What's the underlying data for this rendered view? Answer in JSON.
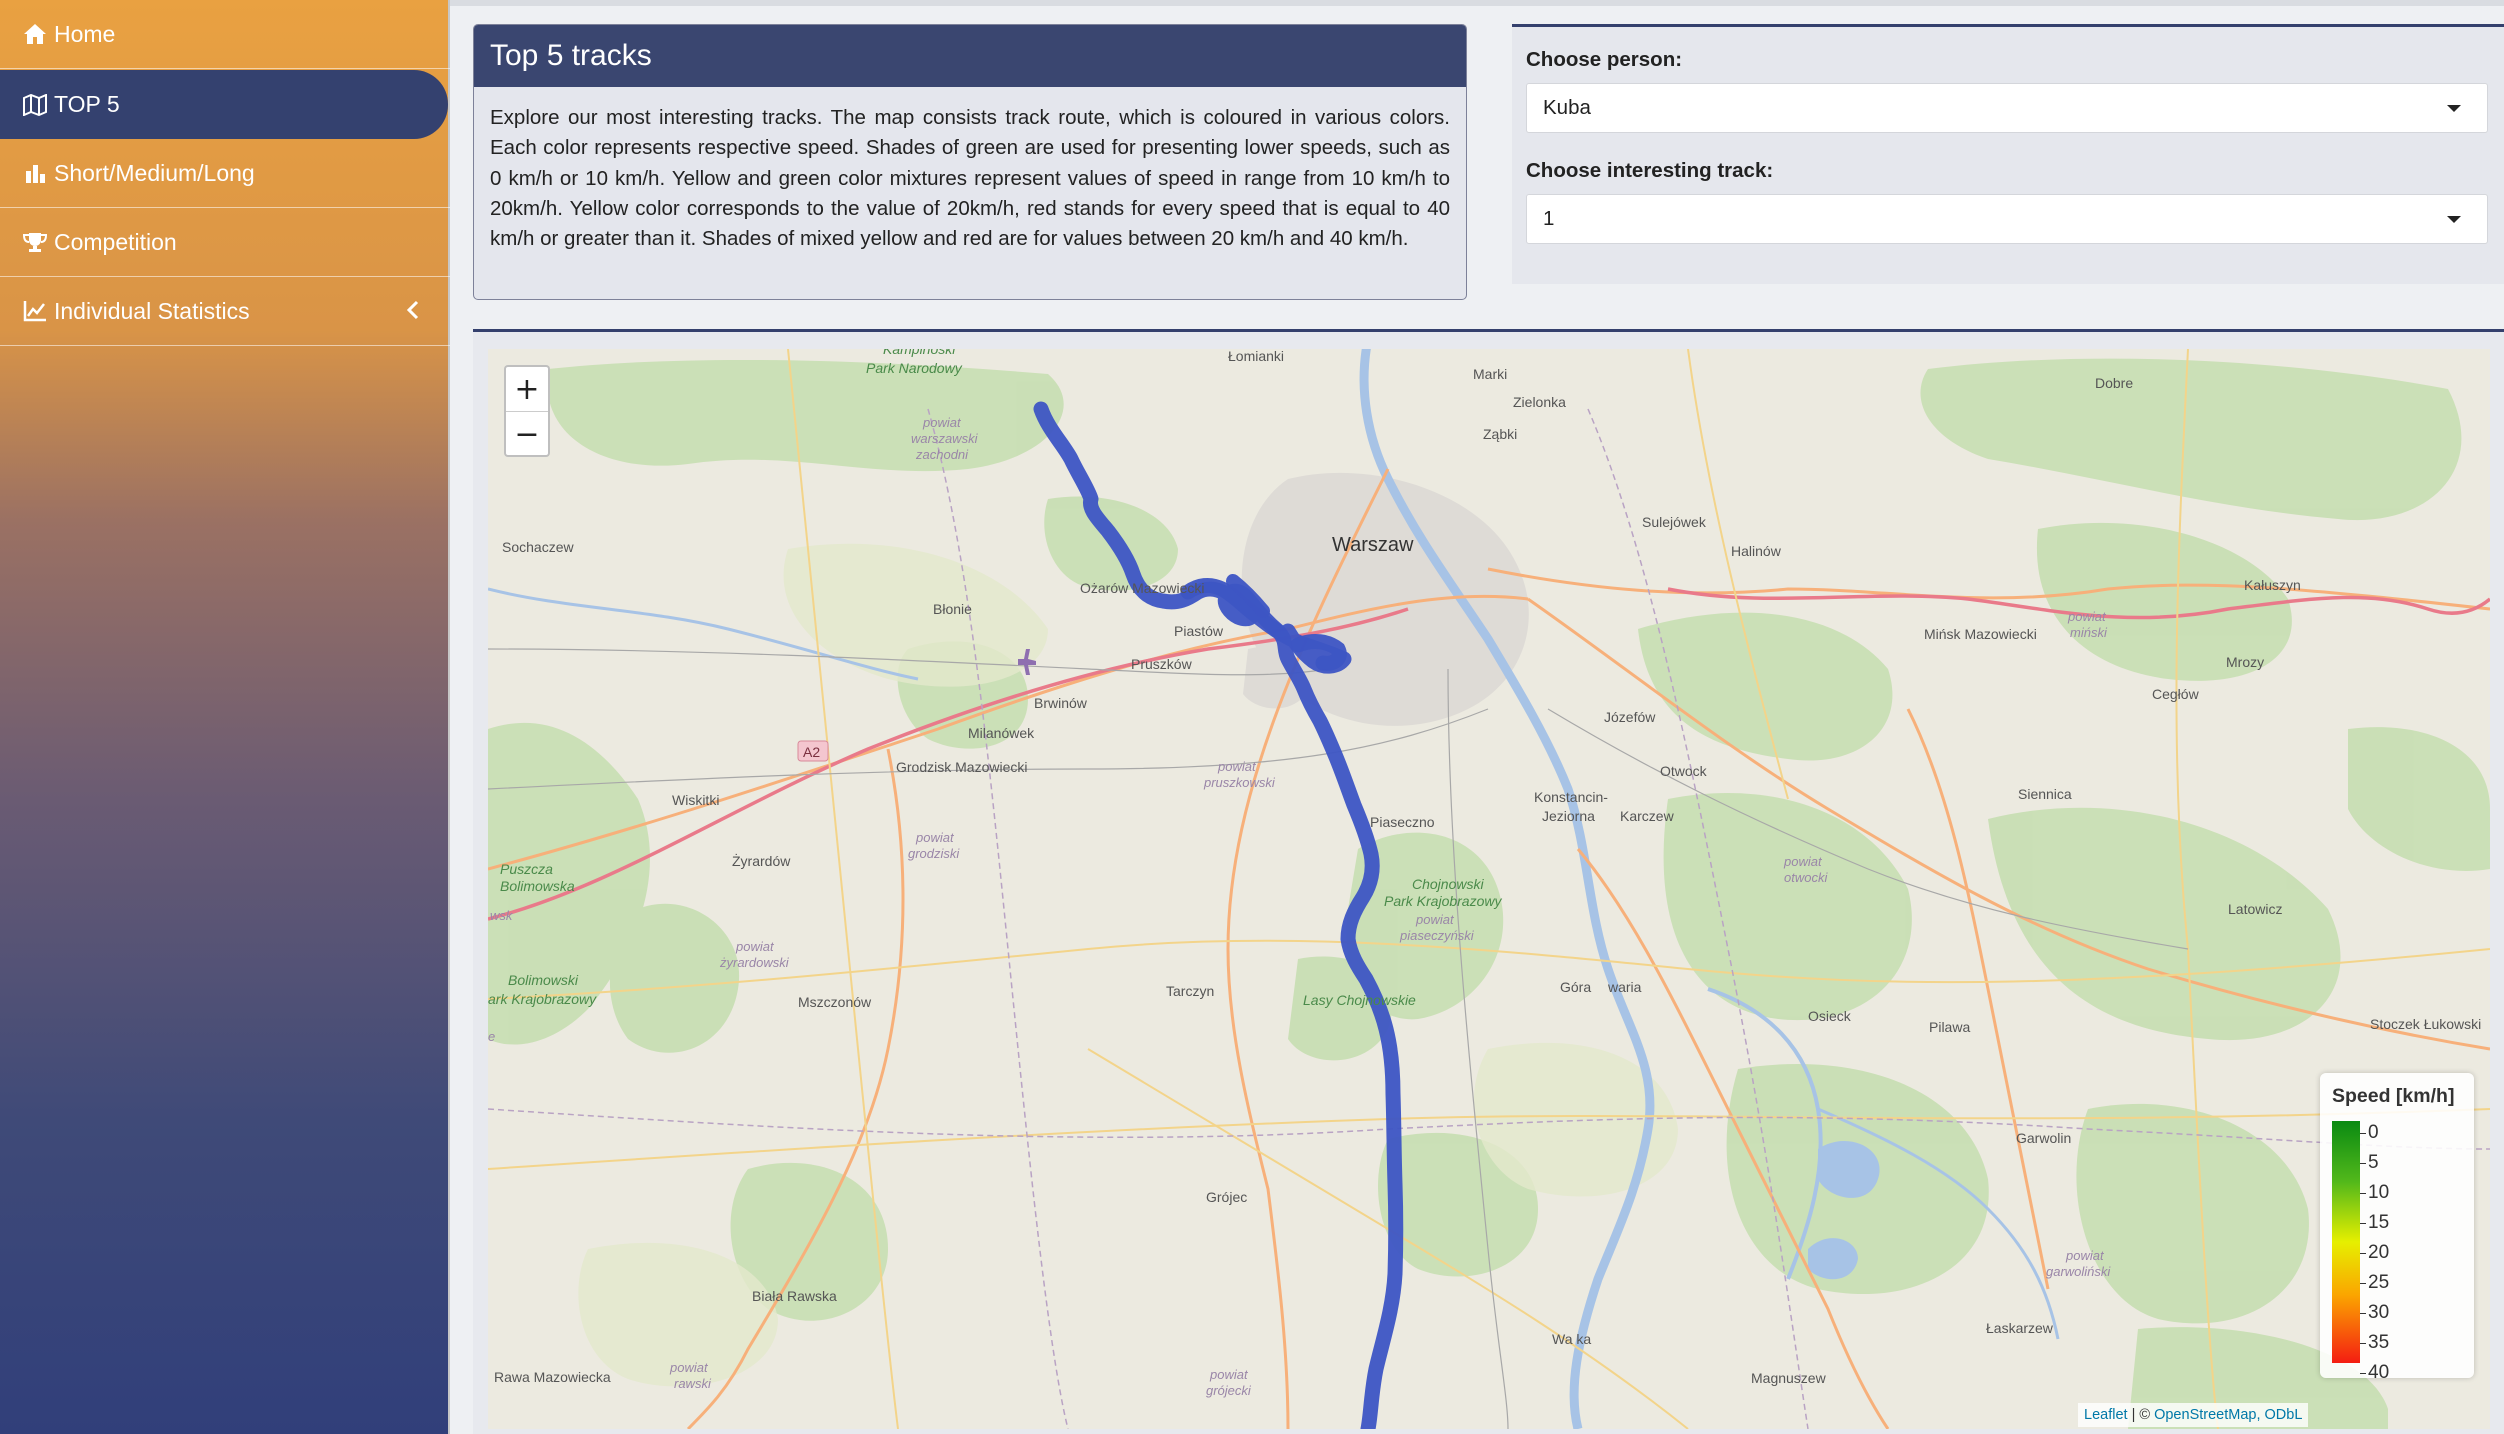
{
  "sidebar": {
    "items": [
      {
        "label": "Home",
        "icon": "home-icon"
      },
      {
        "label": "TOP 5",
        "icon": "map-icon",
        "active": true
      },
      {
        "label": "Short/Medium/Long",
        "icon": "bar-chart-icon"
      },
      {
        "label": "Competition",
        "icon": "trophy-icon"
      },
      {
        "label": "Individual Statistics",
        "icon": "line-chart-icon"
      }
    ]
  },
  "info": {
    "title": "Top 5 tracks",
    "text": "Explore our most interesting tracks. The map consists track route, which is coloured in various colors. Each color represents respective speed. Shades of green are used for presenting lower speeds, such as 0 km/h or 10 km/h. Yellow and green color mixtures represent values of speed in range from 10 km/h to 20km/h. Yellow color corresponds to the value of 20km/h, red stands for every speed that is equal to 40 km/h or greater than it. Shades of mixed yellow and red are for values between 20 km/h and 40 km/h."
  },
  "selectors": {
    "person_label": "Choose person:",
    "person_value": "Kuba",
    "track_label": "Choose interesting track:",
    "track_value": "1"
  },
  "map": {
    "zoom_in": "+",
    "zoom_out": "−",
    "legend_title": "Speed [km/h]",
    "legend_labels": [
      "0",
      "5",
      "10",
      "15",
      "20",
      "25",
      "30",
      "35",
      "40"
    ],
    "attribution_leaflet": "Leaflet",
    "attribution_sep": " | © ",
    "attribution_osm": "OpenStreetMap, ODbL",
    "route_color": "#3d55c4",
    "places": {
      "lomianki": "Łomianki",
      "marki": "Marki",
      "zielonka": "Zielonka",
      "zabki": "Ząbki",
      "kampinoski": "Kampinoski",
      "park_narodowy": "Park Narodowy",
      "dobre": "Dobre",
      "sochaczew": "Sochaczew",
      "warszawa": "Warszaw",
      "sulejowek": "Sulejówek",
      "halinow": "Halinów",
      "kaluszyn": "Kałuszyn",
      "ozarow": "Ożarów Mazowiecki",
      "blonie": "Błonie",
      "piastow": "Piastów",
      "pruszkow": "Pruszków",
      "minsk": "Mińsk Mazowiecki",
      "mrozy": "Mrozy",
      "ceglow": "Cegłów",
      "brwinow": "Brwinów",
      "milanowek": "Milanówek",
      "grodzisk": "Grodzisk Mazowiecki",
      "jozefow": "Józefów",
      "otwock": "Otwock",
      "karczew": "Karczew",
      "wiskitki": "Wiskitki",
      "zyrardow": "Żyrardów",
      "piaseczno": "Piaseczno",
      "konstancin": "Konstancin-",
      "jeziorna": "Jeziorna",
      "siennica": "Siennica",
      "latowicz": "Latowicz",
      "mszczonow": "Mszczonów",
      "tarczyn": "Tarczyn",
      "gora": "Góra",
      "waria": "waria",
      "osieck": "Osieck",
      "pilawa": "Pilawa",
      "stoczek": "Stoczek Łukowski",
      "garwolin": "Garwolin",
      "grojec": "Grójec",
      "biala": "Biała Rawska",
      "laskarzew": "Łaskarzew",
      "rawa": "Rawa Mazowiecka",
      "magnuszew": "Magnuszew",
      "warka": "Wa ka",
      "lasy": "Lasy Chojnowskie",
      "bolimowski": "Bolimowski",
      "park_kraj": "Park Krajobrazowy",
      "puszcza": "Puszcza",
      "bolimowska": "Bolimowska",
      "chojnowski": "Chojnowski",
      "park_kraj2": "Park Krajobrazowy",
      "a2": "A2",
      "pw_warszawski_1": "powiat",
      "pw_warszawski_2": "warszawski",
      "pw_warszawski_3": "zachodni",
      "pw_minski_1": "powiat",
      "pw_minski_2": "miński",
      "pw_pruszkowski_1": "powiat",
      "pw_pruszkowski_2": "pruszkowski",
      "pw_grodziski_1": "powiat",
      "pw_grodziski_2": "grodziski",
      "pw_zyrardowski_1": "powiat",
      "pw_zyrardowski_2": "żyrardowski",
      "pw_piaseczynski_1": "powiat",
      "pw_piaseczynski_2": "piaseczyński",
      "pw_otwocki_1": "powiat",
      "pw_otwocki_2": "otwocki",
      "pw_garwolinski_1": "powiat",
      "pw_garwolinski_2": "garwoliński",
      "pw_grojecki_1": "powiat",
      "pw_grojecki_2": "grójecki",
      "pw_rawski_1": "powiat",
      "pw_rawski_2": "rawski",
      "wsk": "wsk",
      "ark": "ark Krajobrazowy",
      "e": "e"
    }
  }
}
